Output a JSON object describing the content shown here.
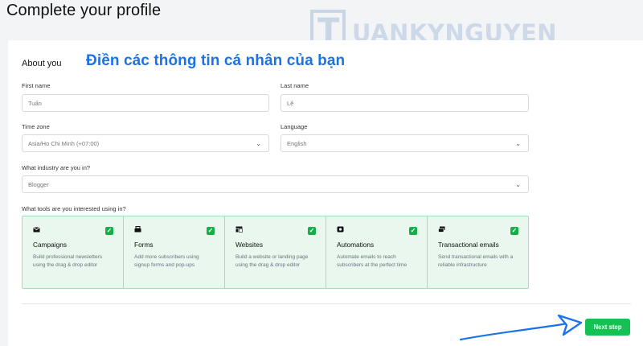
{
  "page": {
    "title": "Complete your profile"
  },
  "watermark": {
    "letter": "T",
    "text": "UANKYNGUYEN"
  },
  "section": {
    "title": "About you"
  },
  "annotation": {
    "text": "Điền các thông tin cá nhân của bạn",
    "color": "#1a73e8"
  },
  "form": {
    "first_name": {
      "label": "First name",
      "value": "Tuấn"
    },
    "last_name": {
      "label": "Last name",
      "value": "Lê"
    },
    "time_zone": {
      "label": "Time zone",
      "value": "Asia/Ho Chi Minh (+07:00)"
    },
    "language": {
      "label": "Language",
      "value": "English"
    },
    "industry": {
      "label": "What industry are you in?",
      "value": "Blogger"
    }
  },
  "tools": {
    "label": "What tools are you interested using in?",
    "items": [
      {
        "name": "Campaigns",
        "desc": "Build professional newsletters using the drag & drop editor",
        "checked": true,
        "icon": "envelope-icon"
      },
      {
        "name": "Forms",
        "desc": "Add more subscribers using signup forms and pop-ups",
        "checked": true,
        "icon": "form-icon"
      },
      {
        "name": "Websites",
        "desc": "Build a website or landing page using the drag & drop editor",
        "checked": true,
        "icon": "layout-icon"
      },
      {
        "name": "Automations",
        "desc": "Automate emails to reach subscribers at the perfect time",
        "checked": true,
        "icon": "automation-icon"
      },
      {
        "name": "Transactional emails",
        "desc": "Send transactional emails with a reliable infrastructure",
        "checked": true,
        "icon": "transactional-email-icon"
      }
    ]
  },
  "actions": {
    "next_label": "Next step"
  },
  "colors": {
    "accent": "#13c253",
    "check": "#13b04a",
    "tool_bg": "#e9f7ee",
    "tool_border": "#a8dcb4"
  }
}
